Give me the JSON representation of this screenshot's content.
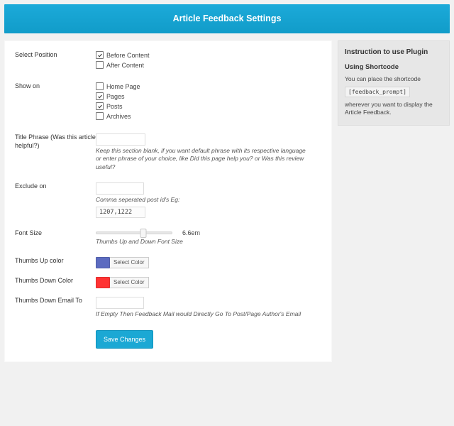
{
  "header": {
    "title": "Article Feedback Settings"
  },
  "form": {
    "position": {
      "label": "Select Position",
      "opts": [
        {
          "label": "Before Content",
          "checked": true
        },
        {
          "label": "After Content",
          "checked": false
        }
      ]
    },
    "showon": {
      "label": "Show on",
      "opts": [
        {
          "label": "Home Page",
          "checked": false
        },
        {
          "label": "Pages",
          "checked": true
        },
        {
          "label": "Posts",
          "checked": true
        },
        {
          "label": "Archives",
          "checked": false
        }
      ]
    },
    "titlephrase": {
      "label": "Title Phrase (Was this article helpful?)",
      "value": "",
      "hint": "Keep this section blank, if you want default phrase with its respective language or enter phrase of your choice, like Did this page help you? or Was this review useful?"
    },
    "exclude": {
      "label": "Exclude on",
      "value": "",
      "hint": "Comma seperated post id's Eg:",
      "example": "1207,1222"
    },
    "fontsize": {
      "label": "Font Size",
      "value": "6.6em",
      "hint": "Thumbs Up and Down Font Size"
    },
    "upcolor": {
      "label": "Thumbs Up color",
      "btn": "Select Color",
      "hex": "#5c6bc0"
    },
    "downcolor": {
      "label": "Thumbs Down Color",
      "btn": "Select Color",
      "hex": "#ff3333"
    },
    "email": {
      "label": "Thumbs Down Email To",
      "value": "",
      "hint": "If Empty Then Feedback Mail would Directly Go To Post/Page Author's Email"
    },
    "save": "Save Changes"
  },
  "sidebar": {
    "title": "Instruction to use Plugin",
    "sub": "Using Shortcode",
    "line1": "You can place the shortcode",
    "shortcode": "[feedback_prompt]",
    "line2": "wherever you want to display the Article Feedback."
  }
}
